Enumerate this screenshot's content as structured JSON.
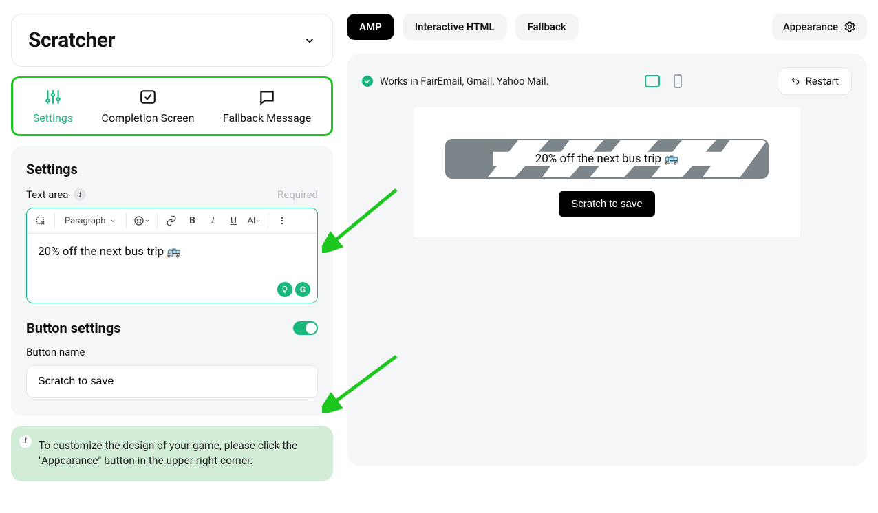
{
  "header": {
    "title": "Scratcher"
  },
  "tabs": {
    "settings": "Settings",
    "completion": "Completion Screen",
    "fallback": "Fallback Message"
  },
  "settings": {
    "title": "Settings",
    "text_area_label": "Text area",
    "required_label": "Required",
    "paragraph_label": "Paragraph",
    "text_value": "20% off the next bus trip 🚌",
    "button_settings_title": "Button settings",
    "button_name_label": "Button name",
    "button_name_value": "Scratch to save"
  },
  "hint": {
    "text": "To customize the design of your game, please click the \"Appearance\" button in the upper right corner."
  },
  "top": {
    "amp": "AMP",
    "ihtml": "Interactive HTML",
    "fallback": "Fallback",
    "appearance": "Appearance"
  },
  "preview": {
    "works_in": "Works in FairEmail, Gmail, Yahoo Mail.",
    "restart": "Restart",
    "scratch_text": "20% off the next bus trip 🚌",
    "scratch_button": "Scratch to save"
  }
}
